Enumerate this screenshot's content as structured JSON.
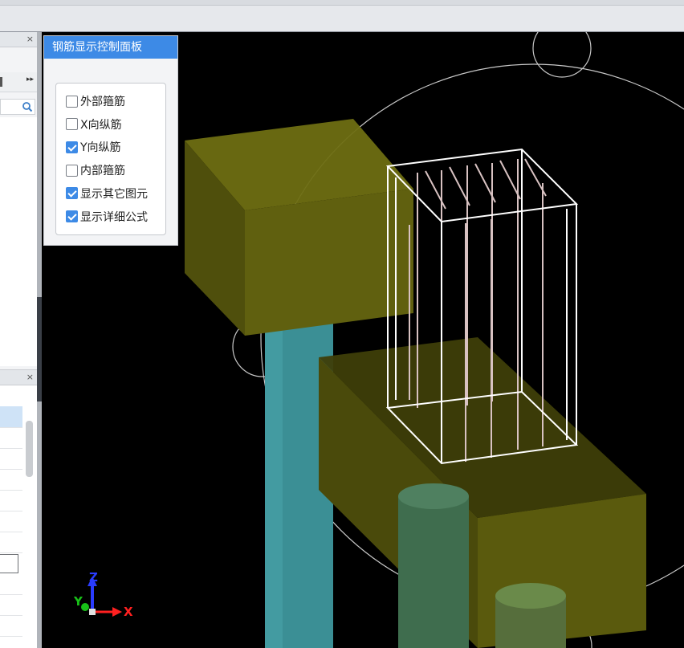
{
  "rebar_panel": {
    "title": "钢筋显示控制面板",
    "options": [
      {
        "label": "外部箍筋",
        "checked": false
      },
      {
        "label": "X向纵筋",
        "checked": false
      },
      {
        "label": "Y向纵筋",
        "checked": true
      },
      {
        "label": "内部箍筋",
        "checked": false
      },
      {
        "label": "显示其它图元",
        "checked": true
      },
      {
        "label": "显示详细公式",
        "checked": true
      }
    ]
  },
  "left_panel": {
    "close_glyph": "×",
    "more_glyph": "▸▸",
    "close_glyph_2": "×"
  },
  "axis_triad": {
    "x": "X",
    "y": "Y",
    "z": "Z"
  },
  "colors": {
    "panel_header": "#3d8ae6",
    "slab": "#5a5a10",
    "column": "#3c8f96",
    "rebar_frame": "#ffffff",
    "rebar_bars": "#d8c2c2"
  }
}
